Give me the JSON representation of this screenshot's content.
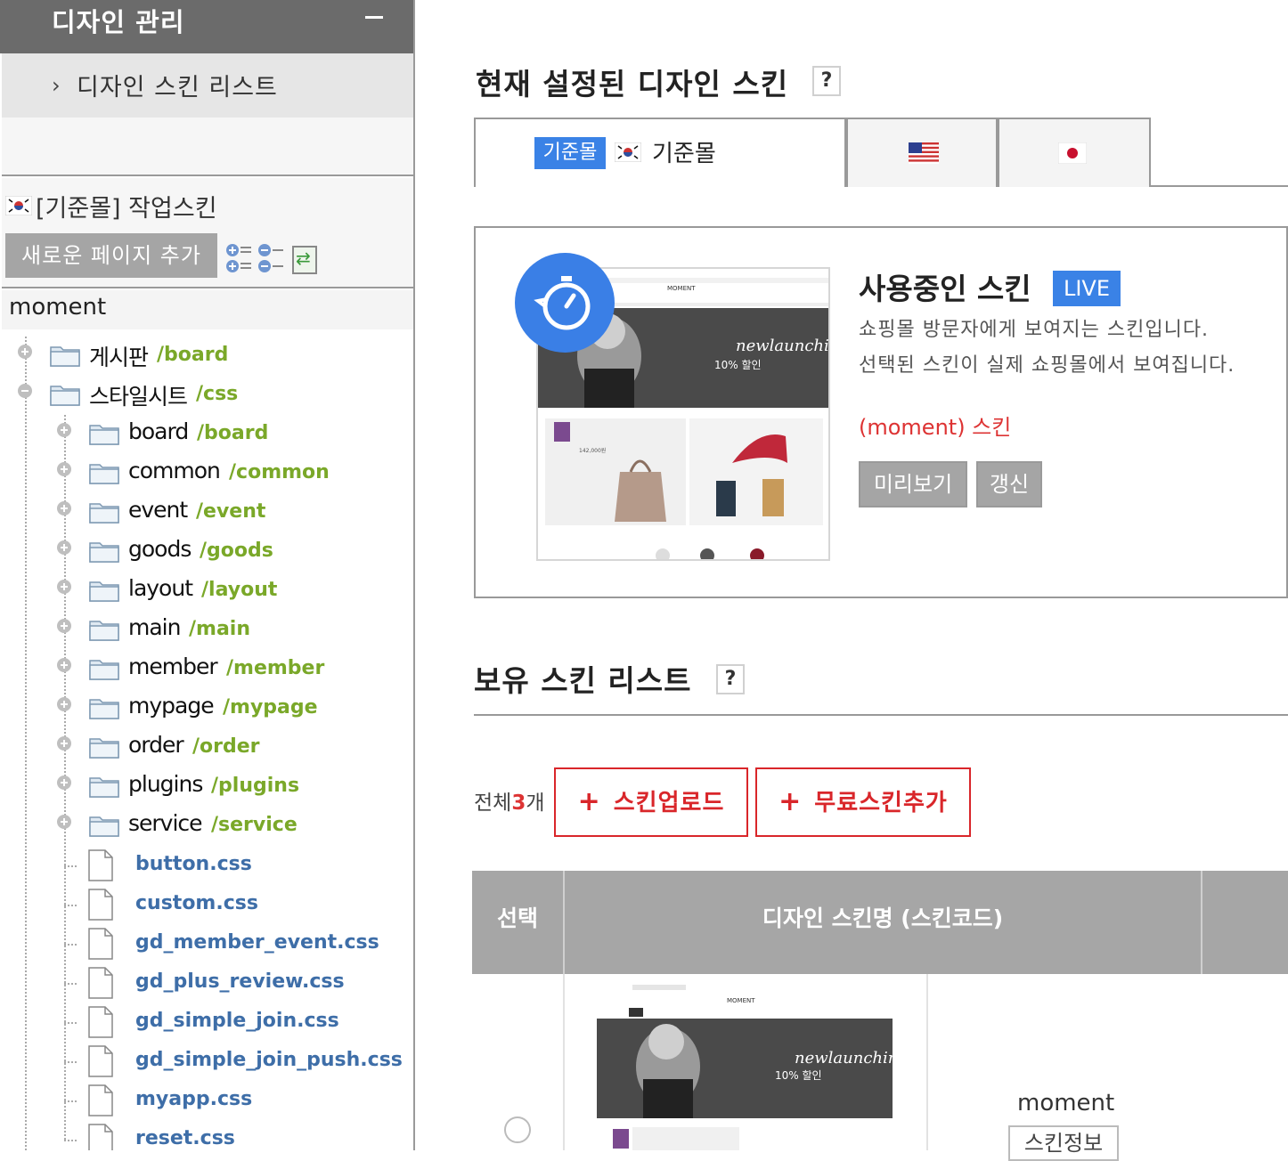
{
  "sidebar": {
    "header_title": "디자인 관리",
    "sub_menu": "디자인 스킨 리스트",
    "work_skin_label": "[기준몰] 작업스킨",
    "add_page_button": "새로운 페이지 추가",
    "root_name": "moment",
    "folders": [
      {
        "name": "게시판",
        "path": "/board",
        "state": "collapsed"
      },
      {
        "name": "스타일시트",
        "path": "/css",
        "state": "expanded"
      }
    ],
    "css_folders": [
      {
        "name": "board",
        "path": "/board"
      },
      {
        "name": "common",
        "path": "/common"
      },
      {
        "name": "event",
        "path": "/event"
      },
      {
        "name": "goods",
        "path": "/goods"
      },
      {
        "name": "layout",
        "path": "/layout"
      },
      {
        "name": "main",
        "path": "/main"
      },
      {
        "name": "member",
        "path": "/member"
      },
      {
        "name": "mypage",
        "path": "/mypage"
      },
      {
        "name": "order",
        "path": "/order"
      },
      {
        "name": "plugins",
        "path": "/plugins"
      },
      {
        "name": "service",
        "path": "/service"
      }
    ],
    "css_files": [
      "button.css",
      "custom.css",
      "gd_member_event.css",
      "gd_plus_review.css",
      "gd_simple_join.css",
      "gd_simple_join_push.css",
      "myapp.css",
      "reset.css"
    ]
  },
  "main": {
    "current_skin_title": "현재 설정된 디자인 스킨",
    "help_label": "?",
    "tabs": {
      "base_badge": "기준몰",
      "base_label": "기준몰"
    },
    "live": {
      "title": "사용중인 스킨",
      "badge": "LIVE",
      "desc1": "쇼핑몰 방문자에게 보여지는 스킨입니다.",
      "desc2": "선택된 스킨이 실제 쇼핑몰에서 보여집니다.",
      "skin_name": "(moment) 스킨",
      "preview_button": "미리보기",
      "refresh_button": "갱신"
    },
    "owned_title": "보유 스킨 리스트",
    "count_prefix": "전체",
    "count_value": "3",
    "count_suffix": "개",
    "upload_button": "스킨업로드",
    "free_add_button": "무료스킨추가",
    "table": {
      "col_select": "선택",
      "col_name": "디자인 스킨명 (스킨코드)",
      "row_name": "moment",
      "row_info_button": "스킨정보"
    },
    "thumb": {
      "brand": "MOMENT",
      "script": "newlaunching",
      "sale": "10% 할인",
      "price": "142,000원"
    }
  },
  "colors": {
    "accent_blue": "#3a82e6",
    "path_green": "#7aa829",
    "file_blue": "#3e6ea8",
    "red": "#d9262a"
  }
}
